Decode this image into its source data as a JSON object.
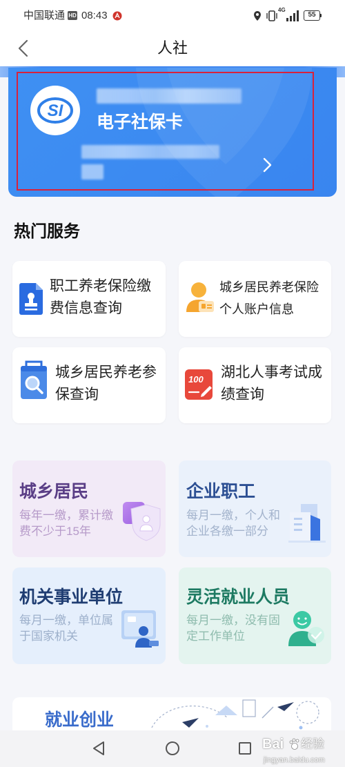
{
  "status_bar": {
    "carrier": "中国联通",
    "hd_badge": "HD",
    "time": "08:43",
    "network_type": "4G",
    "battery_level": "55",
    "icons": [
      "location-icon",
      "vibrate-icon",
      "signal-icon",
      "battery-icon"
    ]
  },
  "header": {
    "back_icon": "chevron-left-icon",
    "title": "人社"
  },
  "social_card": {
    "logo_text": "SI",
    "title": "电子社保卡",
    "arrow_icon": "chevron-right-icon"
  },
  "hot_services": {
    "heading": "热门服务",
    "items": [
      {
        "lines": [
          "职工养老保险缴",
          "费信息查询"
        ],
        "icon": "document-stamp-icon"
      },
      {
        "lines": [
          "城乡居民养老保险",
          "个人账户信息"
        ],
        "icon": "person-account-icon"
      },
      {
        "lines": [
          "城乡居民养老参",
          "保查询"
        ],
        "icon": "search-bag-icon"
      },
      {
        "lines": [
          "湖北人事考试成",
          "绩查询"
        ],
        "icon": "score-100-icon",
        "icon_text": "100"
      }
    ]
  },
  "categories": [
    {
      "title": "城乡居民",
      "lines": [
        "每年一缴，累计缴",
        "费不少于15年"
      ],
      "icon": "shield-person-icon",
      "bg": "#f2eaf7",
      "title_color": "#5a3e86",
      "sub_color": "#b69ac9"
    },
    {
      "title": "企业职工",
      "lines": [
        "每月一缴，个人和",
        "企业各缴一部分"
      ],
      "icon": "building-icon",
      "bg": "#eaf1fb",
      "title_color": "#2c4f93",
      "sub_color": "#a3b3cc"
    },
    {
      "title": "机关事业单位",
      "lines": [
        "每月一缴，单位属",
        "于国家机关"
      ],
      "icon": "office-person-icon",
      "bg": "#e5effc",
      "title_color": "#1f3d72",
      "sub_color": "#9db0cb"
    },
    {
      "title": "灵活就业人员",
      "lines": [
        "每月一缴，没有固",
        "定工作单位"
      ],
      "icon": "flexible-worker-icon",
      "bg": "#e4f4ef",
      "title_color": "#1d7a62",
      "sub_color": "#8fbcae"
    }
  ],
  "banner": {
    "title": "就业创业"
  },
  "nav_bar": {
    "icons": [
      "back-nav-icon",
      "home-nav-icon",
      "recents-nav-icon"
    ]
  },
  "watermark": {
    "brand": "Bai",
    "brand_suffix": "经验",
    "url": "jingyan.baidu.com"
  },
  "colors": {
    "card_blue": "#3b8af1",
    "highlight_red": "#d9213b",
    "page_bg": "#f5f6fa",
    "banner_title": "#3a6ccb"
  }
}
